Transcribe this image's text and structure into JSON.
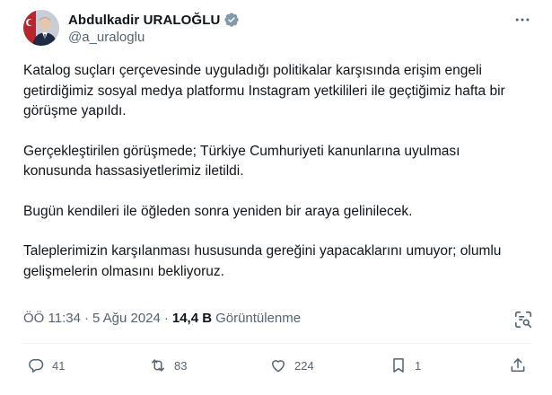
{
  "author": {
    "display_name": "Abdulkadir URALOĞLU",
    "handle": "@a_uraloglu",
    "verified_badge_color": "#829aab"
  },
  "tweet": {
    "paragraphs": [
      "Katalog suçları çerçevesinde uyguladığı politikalar karşısında erişim engeli getirdiğimiz sosyal medya platformu Instagram yetkilileri ile geçtiğimiz hafta bir görüşme yapıldı.",
      "Gerçekleştirilen görüşmede; Türkiye Cumhuriyeti kanunlarına uyulması konusunda hassasiyetlerimiz iletildi.",
      "Bugün kendileri ile öğleden sonra yeniden bir araya gelinilecek.",
      "Taleplerimizin karşılanması hususunda gereğini yapacaklarını umuyor; olumlu gelişmelerin olmasını bekliyoruz."
    ]
  },
  "meta": {
    "time": "ÖÖ 11:34",
    "separator": "·",
    "date": "5 Ağu 2024",
    "views_count": "14,4 B",
    "views_label": "Görüntülenme"
  },
  "actions": {
    "replies": "41",
    "reposts": "83",
    "likes": "224",
    "bookmarks": "1"
  },
  "icons": {
    "more": "more-horizontal-icon",
    "grok": "grok-analyze-icon",
    "reply": "reply-icon",
    "repost": "repost-icon",
    "like": "heart-icon",
    "bookmark": "bookmark-icon",
    "share": "share-icon"
  },
  "colors": {
    "text": "#0f1419",
    "secondary": "#536471",
    "divider": "#eff3f4"
  }
}
